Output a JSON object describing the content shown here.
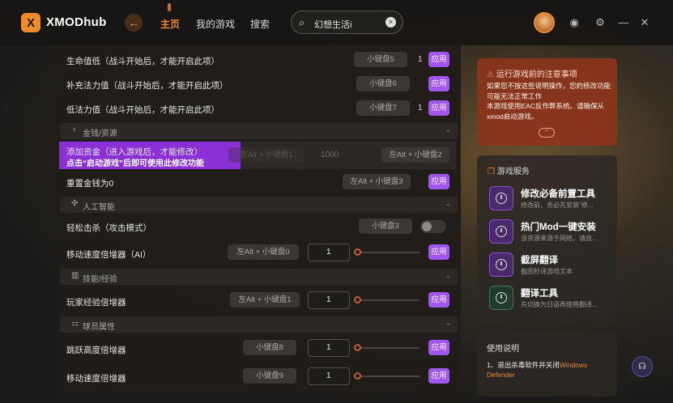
{
  "app": {
    "logo_text": "XMODhub",
    "logo_mark": "X"
  },
  "nav": {
    "back": "←",
    "items": [
      {
        "label": "主页",
        "active": true
      },
      {
        "label": "我的游戏",
        "active": false
      },
      {
        "label": "搜索",
        "active": false
      }
    ]
  },
  "search": {
    "value": "幻想生活i",
    "clear": "×"
  },
  "rows": [
    {
      "label": "生命值低（战斗开始后，才能开启此项）",
      "key": "小键盘5",
      "value": "1",
      "apply": "应用"
    },
    {
      "label": "补充法力值（战斗开始后，才能开启此项）",
      "key": "小键盘6",
      "apply": "应用"
    },
    {
      "label": "低法力值（战斗开始后，才能开启此项）",
      "key": "小键盘7",
      "value": "1",
      "apply": "应用"
    }
  ],
  "sections": {
    "money": "金钱/资源",
    "ai": "人工智能",
    "skills": "技能/经验",
    "player": "球员属性"
  },
  "money_rows": {
    "add": {
      "label": "添加资金（进入游戏后，才能修改）",
      "hint": "点击“启动游戏”后即可使用此修改功能",
      "key_faded": "左Alt + 小键盘1",
      "value_faded": "1000",
      "key": "左Alt + 小键盘2"
    },
    "reset": {
      "label": "重置金钱为0",
      "key": "左Alt + 小键盘3",
      "apply": "应用"
    }
  },
  "ai_rows": {
    "kill": {
      "label": "轻松击杀（攻击模式）",
      "key": "小键盘3"
    },
    "speed": {
      "label": "移动速度倍增器（AI）",
      "key": "左Alt + 小键盘0",
      "value": "1",
      "apply": "应用"
    }
  },
  "skill_rows": {
    "xp": {
      "label": "玩家经验倍增器",
      "key": "左Alt + 小键盘1",
      "value": "1",
      "apply": "应用"
    }
  },
  "player_rows": {
    "jump": {
      "label": "跳跃高度倍增器",
      "key": "小键盘8",
      "value": "1",
      "apply": "应用"
    },
    "move": {
      "label": "移动速度倍增器",
      "key": "小键盘9",
      "value": "1",
      "apply": "应用"
    }
  },
  "notice": {
    "title": "运行游戏前的注意事项",
    "body": "如果您不按这些说明操作，您的修改功能可能无法正常工作\n本游戏使用EAC反作弊系统。请确保从xmod启动游戏。",
    "more": "⌃"
  },
  "services": {
    "title": "游戏服务",
    "items": [
      {
        "title": "修改必备前置工具",
        "desc": "修改前，务必先安装“修..."
      },
      {
        "title": "热门Mod一键安装",
        "desc": "该资源来源于网络，请自..."
      },
      {
        "title": "截屏翻译",
        "desc": "截图秒译游戏文本"
      },
      {
        "title": "翻译工具",
        "desc": "先切换为日语再使用翻译..."
      }
    ]
  },
  "guide": {
    "title": "使用说明",
    "step_prefix": "1、退出杀毒软件并关闭",
    "step_highlight": "Windows Defender"
  },
  "colors": {
    "accent": "#f08b2a",
    "purple": "#a255f0",
    "notice_bg": "#8c341c"
  }
}
